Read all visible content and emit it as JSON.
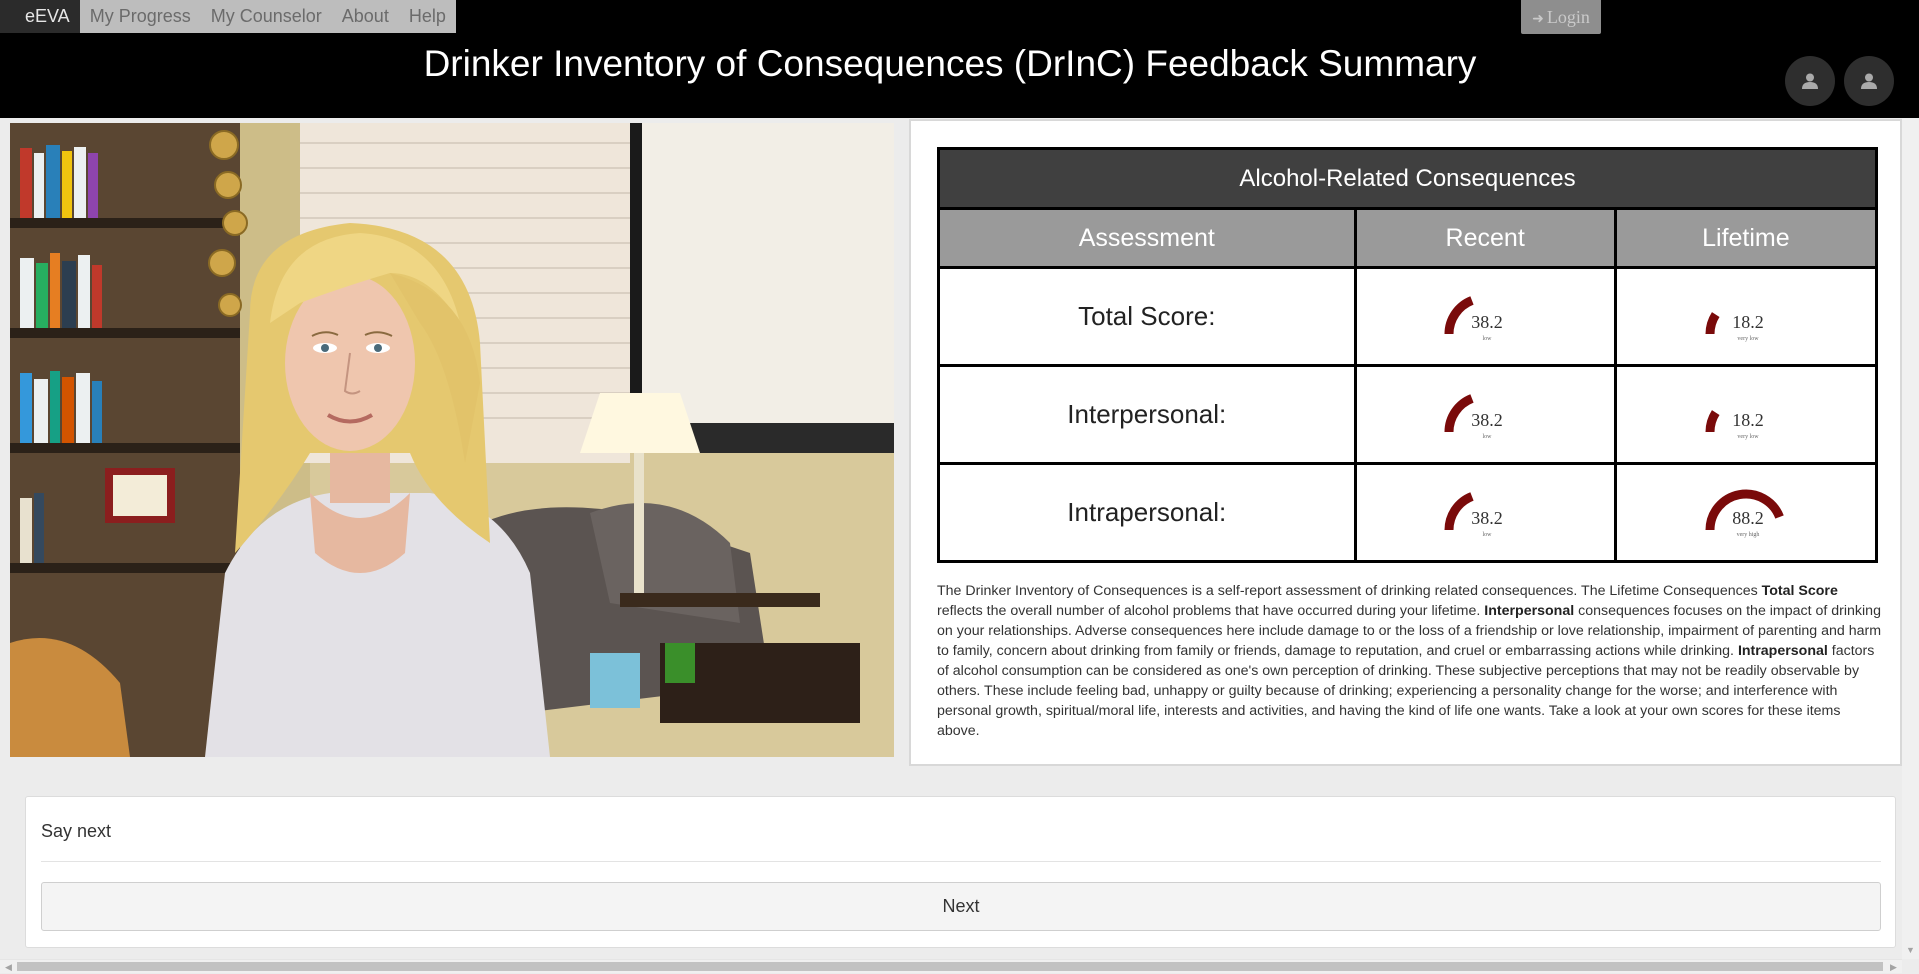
{
  "nav": {
    "brand": "eEVA",
    "items": [
      "My Progress",
      "My Counselor",
      "About",
      "Help"
    ],
    "login_label": "Login"
  },
  "header": {
    "title": "Drinker Inventory of Consequences (DrInC) Feedback Summary"
  },
  "table": {
    "caption": "Alcohol-Related Consequences",
    "columns": [
      "Assessment",
      "Recent",
      "Lifetime"
    ],
    "rows": [
      {
        "label": "Total Score:",
        "recent": {
          "value": "38.2",
          "level": "low",
          "fraction": 0.382
        },
        "lifetime": {
          "value": "18.2",
          "level": "very low",
          "fraction": 0.182
        }
      },
      {
        "label": "Interpersonal:",
        "recent": {
          "value": "38.2",
          "level": "low",
          "fraction": 0.382
        },
        "lifetime": {
          "value": "18.2",
          "level": "very low",
          "fraction": 0.182
        }
      },
      {
        "label": "Intrapersonal:",
        "recent": {
          "value": "38.2",
          "level": "low",
          "fraction": 0.382
        },
        "lifetime": {
          "value": "88.2",
          "level": "very high",
          "fraction": 0.882
        }
      }
    ],
    "gauge_color": "#7a0a0a"
  },
  "description": {
    "p1": "The Drinker Inventory of Consequences is a self-report assessment of drinking related consequences. The Lifetime Consequences ",
    "b1": "Total Score",
    "p2": " reflects the overall number of alcohol problems that have occurred during your lifetime. ",
    "b2": "Interpersonal",
    "p3": " consequences focuses on the impact of drinking on your relationships. Adverse consequences here include damage to or the loss of a friendship or love relationship, impairment of parenting and harm to family, concern about drinking from family or friends, damage to reputation, and cruel or embarrassing actions while drinking. ",
    "b3": "Intrapersonal",
    "p4": " factors of alcohol consumption can be considered as one's own perception of drinking. These subjective perceptions that may not be readily observable by others. These include feeling bad, unhappy or guilty because of drinking; experiencing a personality change for the worse; and interference with personal growth, spiritual/moral life, interests and activities, and having the kind of life one wants. Take a look at your own scores for these items above."
  },
  "bottom": {
    "prompt": "Say next",
    "next_label": "Next"
  },
  "icons": {
    "login": "login-icon",
    "avatar": "user-icon"
  }
}
